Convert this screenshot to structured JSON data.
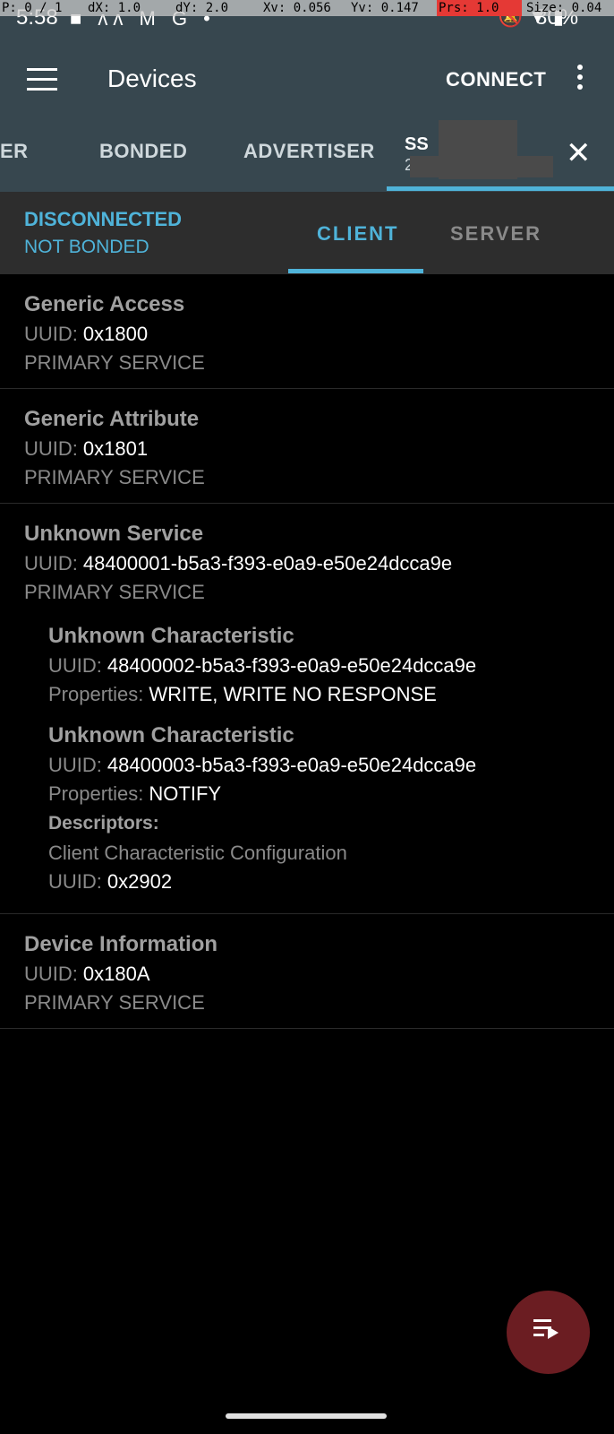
{
  "status": {
    "time": "5:58",
    "battery": "80%",
    "overlay": {
      "p": "P: 0 / 1",
      "dx": "dX: 1.0",
      "dy": "dY: 2.0",
      "xv": "Xv: 0.056",
      "yv": "Yv: 0.147",
      "prs": "Prs: 1.0",
      "size": "Size: 0.04"
    }
  },
  "appbar": {
    "title": "Devices",
    "connect_label": "CONNECT"
  },
  "tabs": {
    "items": [
      "ER",
      "BONDED",
      "ADVERTISER"
    ],
    "active_name": "SS",
    "active_sub": "2"
  },
  "connection": {
    "state": "DISCONNECTED",
    "bond": "NOT BONDED",
    "subtabs": [
      "CLIENT",
      "SERVER"
    ]
  },
  "labels": {
    "uuid": "UUID:",
    "properties": "Properties:",
    "descriptors": "Descriptors:",
    "primary": "PRIMARY SERVICE"
  },
  "services": [
    {
      "name": "Generic Access",
      "uuid": "0x1800"
    },
    {
      "name": "Generic Attribute",
      "uuid": "0x1801"
    },
    {
      "name": "Unknown Service",
      "uuid": "48400001-b5a3-f393-e0a9-e50e24dcca9e",
      "characteristics": [
        {
          "name": "Unknown Characteristic",
          "uuid": "48400002-b5a3-f393-e0a9-e50e24dcca9e",
          "properties": "WRITE, WRITE NO RESPONSE"
        },
        {
          "name": "Unknown Characteristic",
          "uuid": "48400003-b5a3-f393-e0a9-e50e24dcca9e",
          "properties": "NOTIFY",
          "descriptor": {
            "name": "Client Characteristic Configuration",
            "uuid": "0x2902"
          }
        }
      ]
    },
    {
      "name": "Device Information",
      "uuid": "0x180A"
    }
  ],
  "colors": {
    "appbar": "#37474f",
    "accent": "#4fb3d9",
    "fab": "#6b1d22"
  },
  "icons": {
    "menu": "menu-icon",
    "more": "more-vert-icon",
    "close": "close-icon",
    "fab": "playlist-icon"
  }
}
